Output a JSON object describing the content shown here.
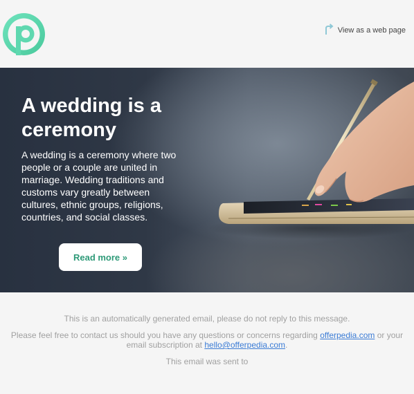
{
  "header": {
    "logo_icon": "offerpedia-p-logo",
    "webpage_link_label": "View as a web page",
    "webpage_link_icon": "redirect-arrow-icon"
  },
  "hero": {
    "title": "A wedding is a ceremony",
    "body": "A wedding is a ceremony where two people or a couple are united in marriage. Wedding traditions and customs vary greatly between cultures, ethnic groups, religions, countries, and social classes.",
    "button_label": "Read more »",
    "image": "hand-with-stylus-on-smartphone"
  },
  "footer": {
    "auto_notice": "This is an automatically generated email, please do not reply to this message.",
    "contact_prefix": "Please feel free to contact us should you have any questions or concerns regarding",
    "site_link": "offerpedia.com",
    "contact_middle": "or your email subscription at",
    "email_link": "hello@offerpedia.com",
    "contact_suffix": ".",
    "sent_to": "This email was sent to"
  },
  "colors": {
    "brand_green": "#5fd8b0",
    "button_text": "#2e9a78",
    "link_blue": "#3a7bd5",
    "footer_text": "#a0a0a0",
    "background": "#f5f5f5"
  }
}
